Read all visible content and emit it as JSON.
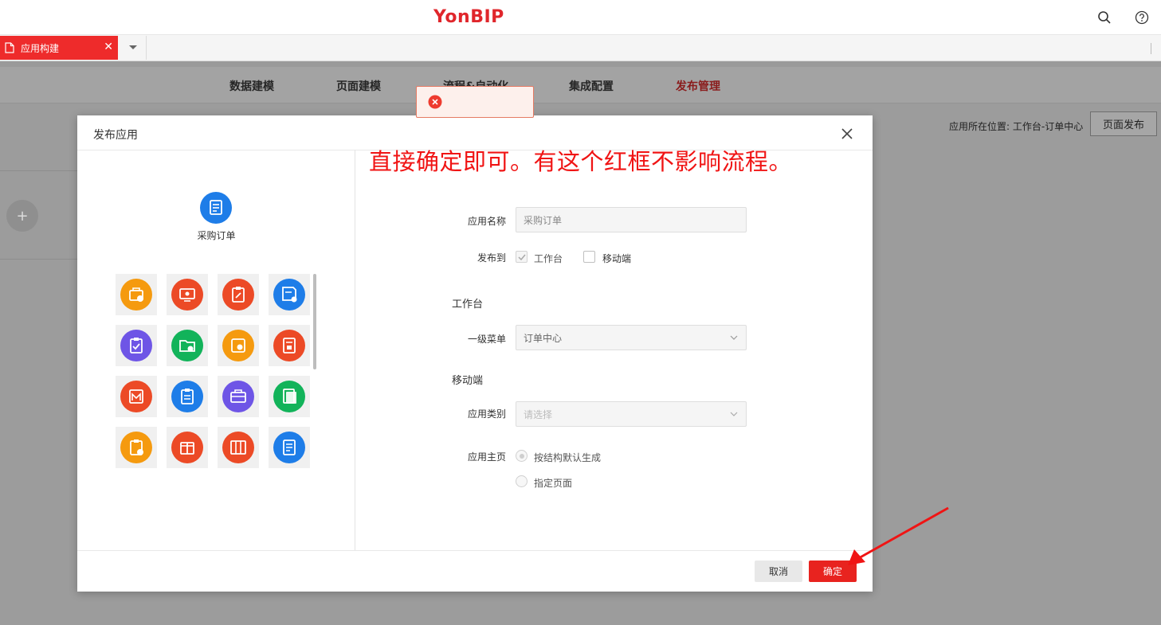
{
  "header": {
    "logo": "YonBIP",
    "search_icon": "search-icon",
    "help_icon": "help-icon"
  },
  "tabs": [
    {
      "label": "应用构建",
      "active": true
    }
  ],
  "subnav": {
    "items": [
      "数据建模",
      "页面建模",
      "流程&自动化",
      "集成配置",
      "发布管理"
    ],
    "active_index": 4
  },
  "page": {
    "location_text": "应用所在位置: 工作台-订单中心",
    "publish_button": "页面发布",
    "add_symbol": "+"
  },
  "toast": {
    "type": "error",
    "icon": "error-circle-icon"
  },
  "modal": {
    "title": "发布应用",
    "annotation": "直接确定即可。有这个红框不影响流程。",
    "app_name_display": "采购订单",
    "icons": [
      {
        "name": "briefcase-chart-icon",
        "color": "#f59a0f"
      },
      {
        "name": "monitor-gear-icon",
        "color": "#ec4a26"
      },
      {
        "name": "clipboard-edit-icon",
        "color": "#ec4a26"
      },
      {
        "name": "doc-gear-icon",
        "color": "#1e7de8"
      },
      {
        "name": "clipboard-check-icon",
        "color": "#6e55e6"
      },
      {
        "name": "folder-gear-icon",
        "color": "#12b35a"
      },
      {
        "name": "box-gear-icon",
        "color": "#f59a0f"
      },
      {
        "name": "doc-stamp-icon",
        "color": "#ec4a26"
      },
      {
        "name": "calendar-icon",
        "color": "#ec4a26"
      },
      {
        "name": "clipboard-list-icon",
        "color": "#1e7de8"
      },
      {
        "name": "toolbox-icon",
        "color": "#6e55e6"
      },
      {
        "name": "book-icon",
        "color": "#12b35a"
      },
      {
        "name": "clipboard-plus-icon",
        "color": "#f59a0f"
      },
      {
        "name": "gift-box-icon",
        "color": "#ec4a26"
      },
      {
        "name": "shelf-icon",
        "color": "#ec4a26"
      },
      {
        "name": "doc-lines-icon",
        "color": "#1e7de8"
      }
    ],
    "form": {
      "app_name_label": "应用名称",
      "app_name_value": "采购订单",
      "publish_to_label": "发布到",
      "publish_workbench": "工作台",
      "publish_mobile": "移动端",
      "workbench_section": "工作台",
      "menu_label": "一级菜单",
      "menu_value": "订单中心",
      "mobile_section": "移动端",
      "category_label": "应用类别",
      "category_placeholder": "请选择",
      "homepage_label": "应用主页",
      "homepage_option1": "按结构默认生成",
      "homepage_option2": "指定页面"
    },
    "cancel": "取消",
    "ok": "确定"
  },
  "colors": {
    "brand": "#e0262b",
    "tab_active": "#ee2b2b",
    "ok_button": "#e8231f",
    "annotation": "#f01414"
  }
}
